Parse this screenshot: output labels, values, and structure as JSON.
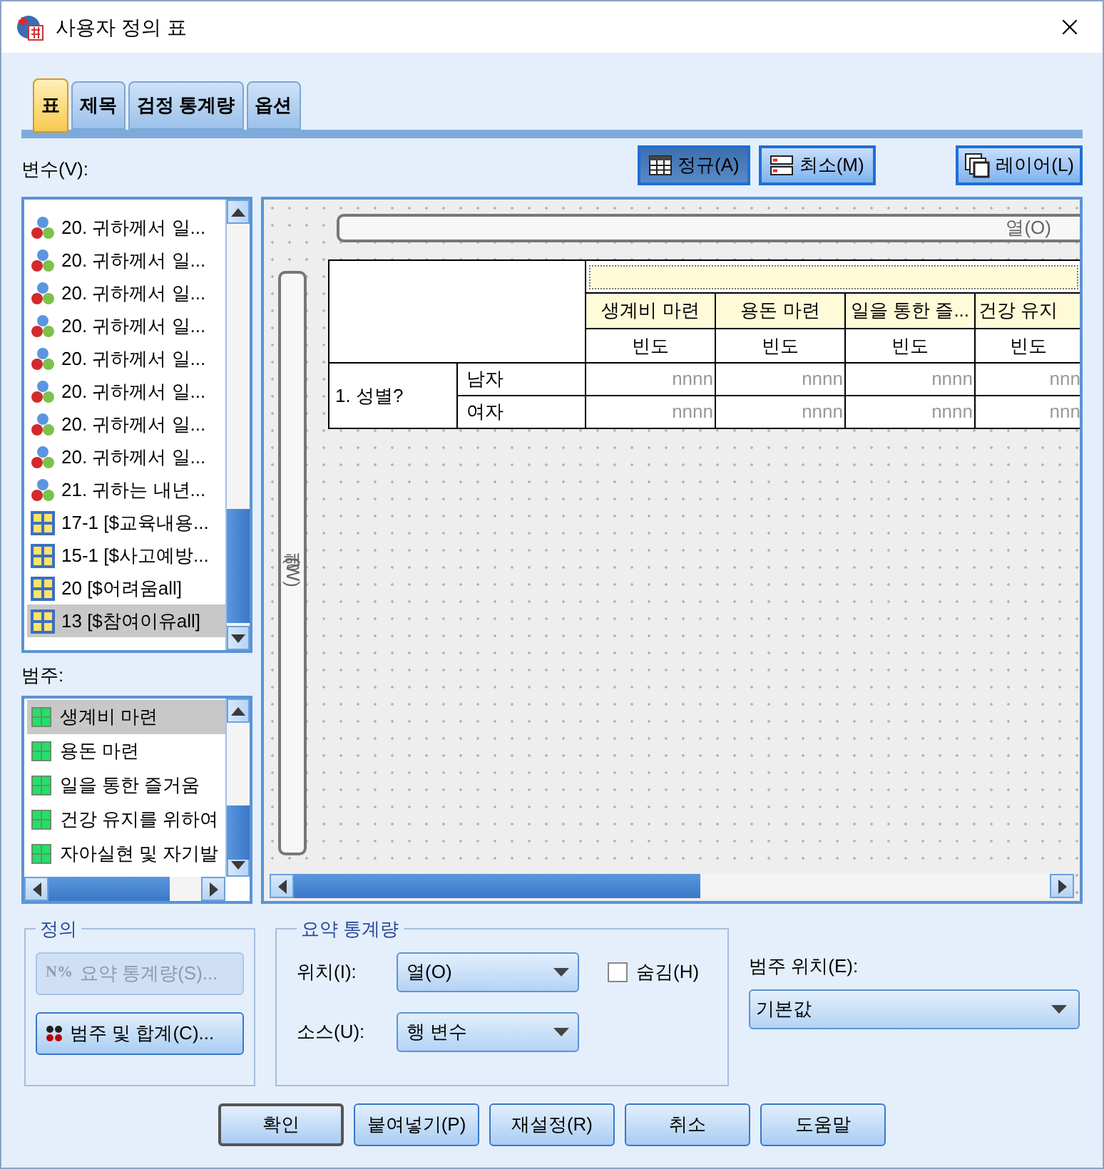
{
  "window": {
    "title": "사용자 정의 표"
  },
  "tabs": [
    {
      "label": "표",
      "selected": true
    },
    {
      "label": "제목",
      "selected": false
    },
    {
      "label": "검정 통계량",
      "selected": false
    },
    {
      "label": "옵션",
      "selected": false
    }
  ],
  "variables": {
    "label": "변수(V):",
    "items": [
      {
        "kind": "nominal",
        "label": "20. 귀하께서 일...",
        "selected": false
      },
      {
        "kind": "nominal",
        "label": "20. 귀하께서 일...",
        "selected": false
      },
      {
        "kind": "nominal",
        "label": "20. 귀하께서 일...",
        "selected": false
      },
      {
        "kind": "nominal",
        "label": "20. 귀하께서 일...",
        "selected": false
      },
      {
        "kind": "nominal",
        "label": "20. 귀하께서 일...",
        "selected": false
      },
      {
        "kind": "nominal",
        "label": "20. 귀하께서 일...",
        "selected": false
      },
      {
        "kind": "nominal",
        "label": "20. 귀하께서 일...",
        "selected": false
      },
      {
        "kind": "nominal",
        "label": "20. 귀하께서 일...",
        "selected": false
      },
      {
        "kind": "nominal",
        "label": "21. 귀하는 내년...",
        "selected": false
      },
      {
        "kind": "set",
        "label": "17-1 [$교육내용...",
        "selected": false
      },
      {
        "kind": "set",
        "label": "15-1 [$사고예방...",
        "selected": false
      },
      {
        "kind": "set",
        "label": "20 [$어려움all]",
        "selected": false
      },
      {
        "kind": "set",
        "label": "13 [$참여이유all]",
        "selected": true
      }
    ]
  },
  "view_buttons": [
    {
      "kind": "normal",
      "label": "정규(A)",
      "selected": true
    },
    {
      "kind": "compact",
      "label": "최소(M)",
      "selected": false
    }
  ],
  "layer_button": {
    "label": "레이어(L)"
  },
  "canvas": {
    "column_bar": "열(O)",
    "row_bar": "행(W)",
    "table": {
      "columns": [
        "생계비 마련",
        "용돈 마련",
        "일을 통한 즐...",
        "건강 유지"
      ],
      "statistics": [
        "빈도",
        "빈도",
        "빈도",
        "빈도"
      ],
      "row_variable": "1. 성별?",
      "rows": [
        {
          "label": "남자",
          "cells": [
            "nnnn",
            "nnnn",
            "nnnn",
            "nnn"
          ]
        },
        {
          "label": "여자",
          "cells": [
            "nnnn",
            "nnnn",
            "nnnn",
            "nnn"
          ]
        }
      ]
    }
  },
  "categories": {
    "label": "범주:",
    "items": [
      {
        "label": "생계비 마련",
        "selected": true
      },
      {
        "label": "용돈 마련",
        "selected": false
      },
      {
        "label": "일을 통한 즐거움",
        "selected": false
      },
      {
        "label": "건강 유지를 위하여",
        "selected": false
      },
      {
        "label": "자아실현 및 자기발",
        "selected": false
      }
    ]
  },
  "definition": {
    "title": "정의",
    "buttons": [
      {
        "kind": "statistics",
        "icon_text": "N%",
        "label": "요약 통계량(S)...",
        "disabled": true
      },
      {
        "kind": "categories",
        "label": "범주 및 합계(C)...",
        "disabled": false
      }
    ]
  },
  "summary": {
    "title": "요약 통계량",
    "position": {
      "label": "위치(I):",
      "value": "열(O)"
    },
    "hide": {
      "label": "숨김(H)",
      "checked": false
    },
    "source": {
      "label": "소스(U):",
      "value": "행 변수"
    }
  },
  "category_position": {
    "label": "범주 위치(E):",
    "value": "기본값"
  },
  "buttons": [
    {
      "label": "확인",
      "default": true
    },
    {
      "label": "붙여넣기(P)",
      "default": false
    },
    {
      "label": "재설정(R)",
      "default": false
    },
    {
      "label": "취소",
      "default": false
    },
    {
      "label": "도움말",
      "default": false
    }
  ]
}
